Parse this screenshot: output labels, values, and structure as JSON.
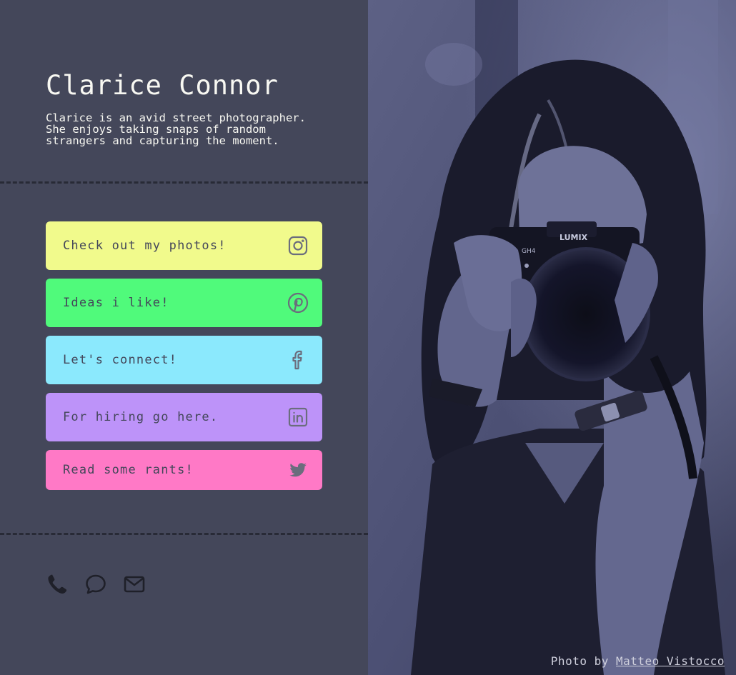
{
  "profile": {
    "name": "Clarice Connor",
    "bio": "Clarice is an avid street photographer. She enjoys taking snaps of random strangers and capturing the moment."
  },
  "links": [
    {
      "label": "Check out my photos!",
      "icon": "instagram-icon",
      "color": "#f1fa8c"
    },
    {
      "label": "Ideas i like!",
      "icon": "pinterest-icon",
      "color": "#50fa7b"
    },
    {
      "label": "Let's connect!",
      "icon": "facebook-icon",
      "color": "#8be9fd"
    },
    {
      "label": "For hiring go here.",
      "icon": "linkedin-icon",
      "color": "#bd93f9"
    },
    {
      "label": "Read some rants!",
      "icon": "twitter-icon",
      "color": "#ff79c6"
    }
  ],
  "contacts": [
    {
      "icon": "phone-icon"
    },
    {
      "icon": "chat-bubble-icon"
    },
    {
      "icon": "mail-icon"
    }
  ],
  "credit": {
    "prefix": "Photo by",
    "author": "Matteo Vistocco"
  },
  "theme": {
    "background": "#44475a",
    "divider": "#282a36",
    "text": "#f8f8f2",
    "photo_tint": "#6a6f9a"
  }
}
